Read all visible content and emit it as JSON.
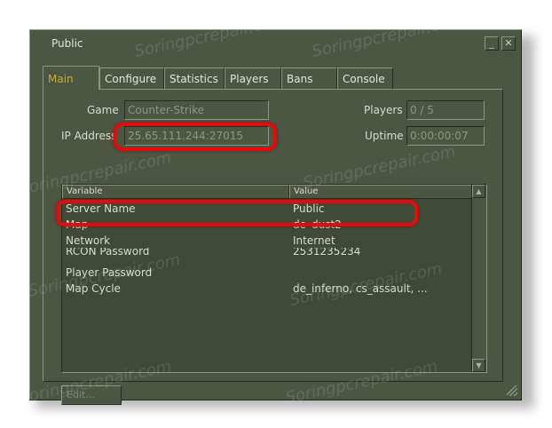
{
  "window": {
    "title": "Public",
    "minimize_glyph": "_",
    "close_glyph": "✕"
  },
  "tabs": [
    {
      "label": "Main",
      "active": true
    },
    {
      "label": "Configure"
    },
    {
      "label": "Statistics"
    },
    {
      "label": "Players"
    },
    {
      "label": "Bans"
    },
    {
      "label": "Console"
    }
  ],
  "fields": {
    "game_label": "Game",
    "game_value": "Counter-Strike",
    "ip_label": "IP Address",
    "ip_value": "25.65.111.244:27015",
    "players_label": "Players",
    "players_value": "0 / 5",
    "uptime_label": "Uptime",
    "uptime_value": "0:00:00:07"
  },
  "table": {
    "columns": [
      "Variable",
      "Value"
    ],
    "rows": [
      {
        "variable": "Server Name",
        "value": "Public"
      },
      {
        "variable": "Map",
        "value": "de_dust2"
      },
      {
        "variable": "Network",
        "value": "Internet"
      },
      {
        "variable": "RCON Password",
        "value": "2531235234"
      },
      {
        "variable": "Player Password",
        "value": ""
      },
      {
        "variable": "Map Cycle",
        "value": "de_inferno, cs_assault, ..."
      }
    ]
  },
  "edit_button": "Edit...",
  "watermark": "Soringpcrepair.com",
  "colors": {
    "highlight": "#e60a0a",
    "active_tab": "#c9a93a",
    "window_bg": "#4b5743"
  }
}
